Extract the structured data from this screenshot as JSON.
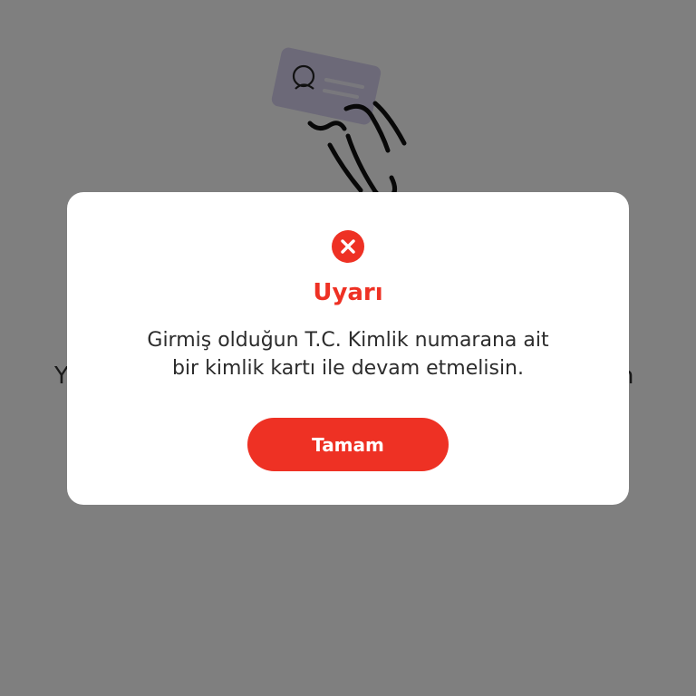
{
  "background": {
    "text_left_fragment": "Y",
    "text_right_fragment": "n"
  },
  "dialog": {
    "icon": "error-x-circle-icon",
    "title": "Uyarı",
    "message_line1": "Girmiş olduğun T.C. Kimlik numarana ait",
    "message_line2": "bir kimlik kartı ile devam etmelisin.",
    "ok_button_label": "Tamam"
  },
  "colors": {
    "accent": "#ee3124",
    "overlay": "rgba(0,0,0,0.5)",
    "card": "#d8d2f0"
  }
}
